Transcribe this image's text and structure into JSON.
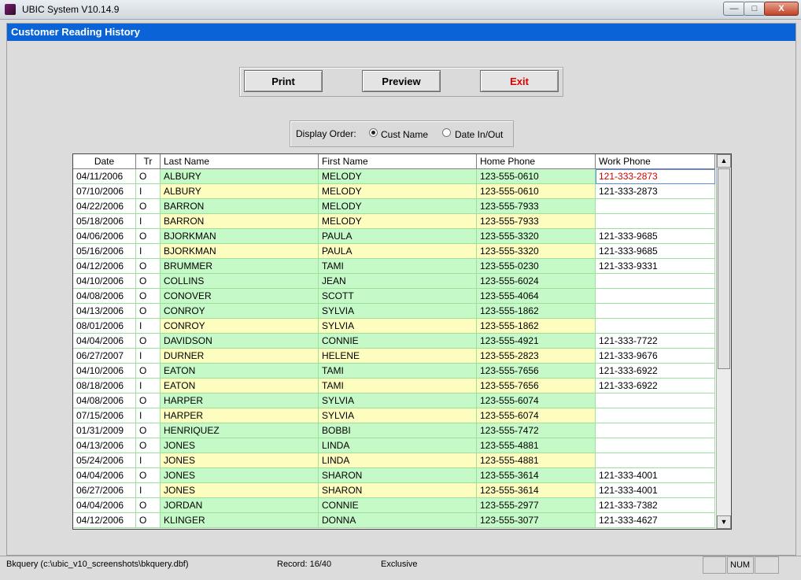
{
  "window": {
    "title": "UBIC System V10.14.9",
    "controls": {
      "minimize": "—",
      "maximize": "□",
      "close": "X"
    }
  },
  "form": {
    "title": "Customer Reading History"
  },
  "buttons": {
    "print": "Print",
    "preview": "Preview",
    "exit": "Exit"
  },
  "display_order": {
    "label": "Display Order:",
    "options": [
      "Cust Name",
      "Date In/Out"
    ],
    "selected": "Cust Name"
  },
  "grid": {
    "columns": [
      "Date",
      "Tr",
      "Last Name",
      "First Name",
      "Home Phone",
      "Work Phone"
    ],
    "rows": [
      [
        "04/11/2006",
        "O",
        "ALBURY",
        "MELODY",
        "123-555-0610",
        "121-333-2873"
      ],
      [
        "07/10/2006",
        "I",
        "ALBURY",
        "MELODY",
        "123-555-0610",
        "121-333-2873"
      ],
      [
        "04/22/2006",
        "O",
        "BARRON",
        "MELODY",
        "123-555-7933",
        ""
      ],
      [
        "05/18/2006",
        "I",
        "BARRON",
        "MELODY",
        "123-555-7933",
        ""
      ],
      [
        "04/06/2006",
        "O",
        "BJORKMAN",
        "PAULA",
        "123-555-3320",
        "121-333-9685"
      ],
      [
        "05/16/2006",
        "I",
        "BJORKMAN",
        "PAULA",
        "123-555-3320",
        "121-333-9685"
      ],
      [
        "04/12/2006",
        "O",
        "BRUMMER",
        "TAMI",
        "123-555-0230",
        "121-333-9331"
      ],
      [
        "04/10/2006",
        "O",
        "COLLINS",
        "JEAN",
        "123-555-6024",
        ""
      ],
      [
        "04/08/2006",
        "O",
        "CONOVER",
        "SCOTT",
        "123-555-4064",
        ""
      ],
      [
        "04/13/2006",
        "O",
        "CONROY",
        "SYLVIA",
        "123-555-1862",
        ""
      ],
      [
        "08/01/2006",
        "I",
        "CONROY",
        "SYLVIA",
        "123-555-1862",
        ""
      ],
      [
        "04/04/2006",
        "O",
        "DAVIDSON",
        "CONNIE",
        "123-555-4921",
        "121-333-7722"
      ],
      [
        "06/27/2007",
        "I",
        "DURNER",
        "HELENE",
        "123-555-2823",
        "121-333-9676"
      ],
      [
        "04/10/2006",
        "O",
        "EATON",
        "TAMI",
        "123-555-7656",
        "121-333-6922"
      ],
      [
        "08/18/2006",
        "I",
        "EATON",
        "TAMI",
        "123-555-7656",
        "121-333-6922"
      ],
      [
        "04/08/2006",
        "O",
        "HARPER",
        "SYLVIA",
        "123-555-6074",
        ""
      ],
      [
        "07/15/2006",
        "I",
        "HARPER",
        "SYLVIA",
        "123-555-6074",
        ""
      ],
      [
        "01/31/2009",
        "O",
        "HENRIQUEZ",
        "BOBBI",
        "123-555-7472",
        ""
      ],
      [
        "04/13/2006",
        "O",
        "JONES",
        "LINDA",
        "123-555-4881",
        ""
      ],
      [
        "05/24/2006",
        "I",
        "JONES",
        "LINDA",
        "123-555-4881",
        ""
      ],
      [
        "04/04/2006",
        "O",
        "JONES",
        "SHARON",
        "123-555-3614",
        "121-333-4001"
      ],
      [
        "06/27/2006",
        "I",
        "JONES",
        "SHARON",
        "123-555-3614",
        "121-333-4001"
      ],
      [
        "04/04/2006",
        "O",
        "JORDAN",
        "CONNIE",
        "123-555-2977",
        "121-333-7382"
      ],
      [
        "04/12/2006",
        "O",
        "KLINGER",
        "DONNA",
        "123-555-3077",
        "121-333-4627"
      ]
    ],
    "scroll": {
      "up": "▲",
      "down": "▼"
    }
  },
  "status": {
    "path": "Bkquery (c:\\ubic_v10_screenshots\\bkquery.dbf)",
    "record": "Record: 16/40",
    "mode": "Exclusive",
    "num": "NUM"
  },
  "colors": {
    "header_blue": "#0a64d8",
    "out_row": "#c6f9c8",
    "in_row": "#fdfdc0",
    "exit_text": "#e00000",
    "active_cell_text": "#d40000"
  }
}
